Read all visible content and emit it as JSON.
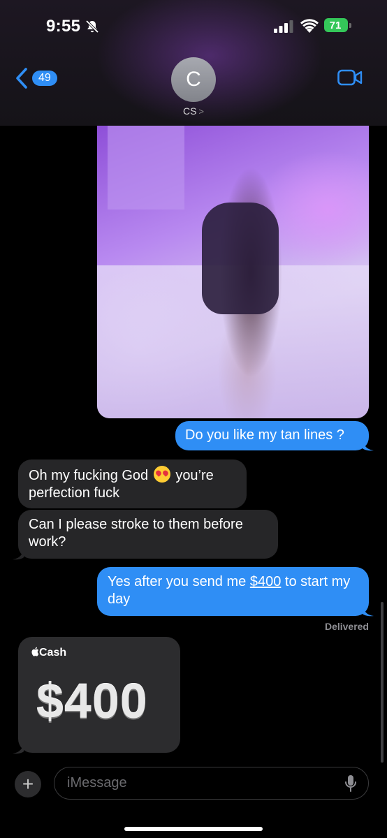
{
  "status_bar": {
    "time": "9:55",
    "battery": "71"
  },
  "header": {
    "back_count": "49",
    "avatar_initial": "C",
    "contact_name": "CS",
    "contact_chevron": ">"
  },
  "messages": [
    {
      "direction": "outgoing",
      "text": "Do you like my tan lines ?"
    },
    {
      "direction": "incoming",
      "text_before_emoji": "Oh my fucking God",
      "emoji": "heart-eyes-emoji",
      "text_after_emoji": "you’re perfection fuck"
    },
    {
      "direction": "incoming",
      "text": "Can I please stroke to them before work?"
    },
    {
      "direction": "outgoing",
      "text_before_link": "Yes after you send me ",
      "link": "$400",
      "text_after_link": " to start my day"
    }
  ],
  "delivery_status": "Delivered",
  "cash_card": {
    "label": "Cash",
    "amount": "$400"
  },
  "composer": {
    "placeholder": "iMessage"
  },
  "colors": {
    "outgoing_bubble": "#2f8ef5",
    "incoming_bubble": "#262628",
    "battery": "#34c759"
  }
}
